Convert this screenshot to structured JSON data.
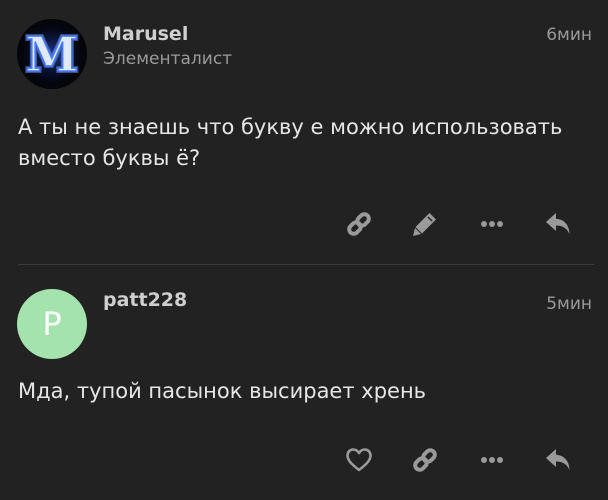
{
  "posts": [
    {
      "username": "Marusel",
      "user_title": "Элементалист",
      "time": "6мин",
      "body_lines": [
        "А ты не знаешь что букву е можно использовать",
        "вместо буквы ё?"
      ],
      "avatar_letter": "M",
      "actions": [
        "link-icon",
        "pencil-icon",
        "ellipsis-icon",
        "reply-icon"
      ]
    },
    {
      "username": "patt228",
      "time": "5мин",
      "body_lines": [
        "Мда, тупой пасынок высирает хрень"
      ],
      "avatar_letter": "P",
      "avatar_color": "#a4e3ad",
      "actions": [
        "heart-icon",
        "link-icon",
        "ellipsis-icon",
        "reply-icon"
      ]
    }
  ],
  "colors": {
    "background": "#222222",
    "text": "#e6e6e6",
    "muted": "#9a9a9a",
    "icon": "#9a9a9a",
    "divider": "#3a3a3a"
  }
}
